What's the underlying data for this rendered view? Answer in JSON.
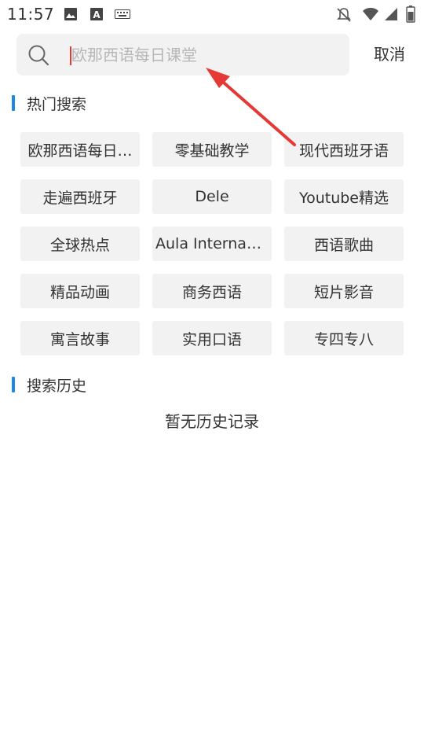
{
  "status_bar": {
    "time": "11:57",
    "left_icons": [
      "image-icon",
      "text-a-icon",
      "keyboard-icon"
    ],
    "right_icons": [
      "notifications-off-icon",
      "wifi-icon",
      "cellular-signal-icon",
      "battery-icon"
    ]
  },
  "search": {
    "placeholder": "欧那西语每日课堂",
    "value": "",
    "cancel_label": "取消"
  },
  "hot_search": {
    "title": "热门搜索",
    "items": [
      "欧那西语每日课堂",
      "零基础教学",
      "现代西班牙语",
      "走遍西班牙",
      "Dele",
      "Youtube精选",
      "全球热点",
      "Aula Internacional",
      "西语歌曲",
      "精品动画",
      "商务西语",
      "短片影音",
      "寓言故事",
      "实用口语",
      "专四专八"
    ],
    "displayed": [
      "欧那西语每日…",
      "零基础教学",
      "现代西班牙语",
      "走遍西班牙",
      "Dele",
      "Youtube精选",
      "全球热点",
      "Aula Internacio…",
      "西语歌曲",
      "精品动画",
      "商务西语",
      "短片影音",
      "寓言故事",
      "实用口语",
      "专四专八"
    ]
  },
  "search_history": {
    "title": "搜索历史",
    "empty_text": "暂无历史记录"
  },
  "colors": {
    "accent_bar": "#1e88e5",
    "chip_bg": "#f2f2f2",
    "annotation_arrow": "#e53935"
  }
}
